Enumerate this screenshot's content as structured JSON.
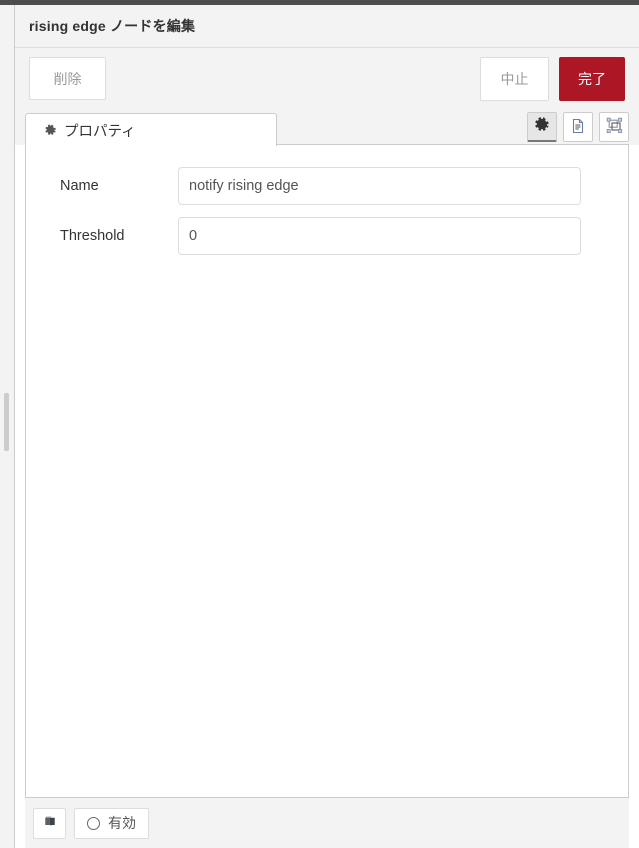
{
  "window": {
    "title": "rising edge ノードを編集"
  },
  "toolbar": {
    "delete_label": "削除",
    "cancel_label": "中止",
    "done_label": "完了",
    "done_color": "#ad1625"
  },
  "tabs": [
    {
      "id": "properties",
      "label": "プロパティ",
      "icon": "gear-icon",
      "active": true
    }
  ],
  "tab_tools": [
    {
      "id": "properties",
      "icon": "gear-icon",
      "active": true
    },
    {
      "id": "description",
      "icon": "document-icon",
      "active": false
    },
    {
      "id": "appearance",
      "icon": "appearance-icon",
      "active": false
    }
  ],
  "form": {
    "fields": [
      {
        "label": "Name",
        "value": "notify rising edge",
        "placeholder": "Name"
      },
      {
        "label": "Threshold",
        "value": "0",
        "placeholder": "Threshold"
      }
    ]
  },
  "footer": {
    "help_icon": "book-icon",
    "enable_label": "有効",
    "enable_state_icon": "circle-icon"
  }
}
